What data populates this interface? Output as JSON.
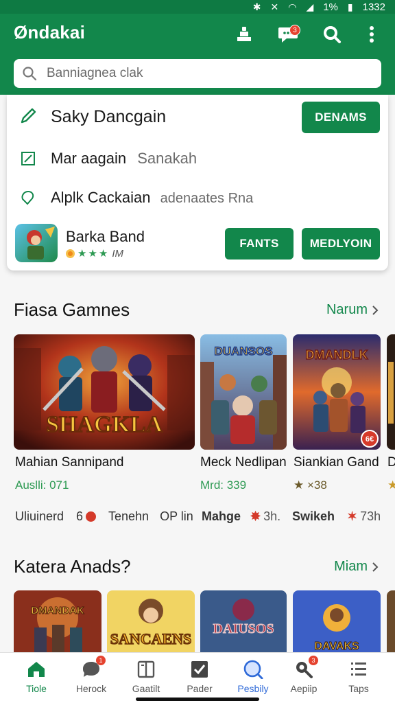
{
  "status_bar": {
    "time": "1332",
    "battery_text": "1%"
  },
  "header": {
    "app_title": "Øndakai",
    "chat_badge": "3"
  },
  "search": {
    "placeholder": "Banniagnea clak"
  },
  "dropdown": {
    "rows": [
      {
        "label": "Saky Dancgain",
        "button": "DENAMS"
      },
      {
        "label": "Mar aagain",
        "sub": "Sanakah"
      },
      {
        "label": "Alplk Cackaian",
        "sub": "adenaates Rna"
      }
    ],
    "app_result": {
      "name": "Barka Band",
      "rating_text": "IM",
      "button1": "FANTS",
      "button2": "MEDLYOIN"
    }
  },
  "section1": {
    "title": "Fiasa Gamnes",
    "more": "Narum",
    "games": [
      {
        "banner_text": "SHAGKLA",
        "name": "Mahian Sannipand",
        "sub": "Auslli: 071",
        "meta": "Uliuinerd",
        "meta_icon": "6"
      },
      {
        "banner_text": "DUANSOS",
        "name": "Meck Nedlipan",
        "sub": "Mrd: 339",
        "meta": "Tenehn",
        "meta2": "OP lin"
      },
      {
        "banner_text": "DMANDLK",
        "name": "Siankian Gand",
        "sub": "★ ×38",
        "meta": "Mahge",
        "meta_time": "3h.",
        "corner_badge": "6€"
      },
      {
        "name": "D",
        "sub": "★",
        "meta": "Swikeh",
        "meta_time": "73h"
      }
    ]
  },
  "section2": {
    "title": "Katera Anads?",
    "more": "Miam",
    "tiles": [
      {
        "banner_text": "DMANDAK"
      },
      {
        "banner_text": "SANCAENS"
      },
      {
        "banner_text": "DAIUSOS"
      },
      {
        "banner_text": "DAVAKS"
      }
    ]
  },
  "bottom_nav": {
    "items": [
      {
        "label": "Tiole",
        "icon": "home-icon",
        "active": true
      },
      {
        "label": "Herock",
        "icon": "chat-icon",
        "badge": "1"
      },
      {
        "label": "Gaatilt",
        "icon": "book-icon"
      },
      {
        "label": "Pader",
        "icon": "checkbox-icon"
      },
      {
        "label": "Pesbily",
        "icon": "search-circle-icon"
      },
      {
        "label": "Aepiip",
        "icon": "magnifier-icon",
        "badge": "3"
      },
      {
        "label": "Taps",
        "icon": "list-icon"
      }
    ]
  },
  "colors": {
    "brand": "#12874b",
    "brand_dark": "#0e7a43",
    "badge": "#e5432f"
  }
}
